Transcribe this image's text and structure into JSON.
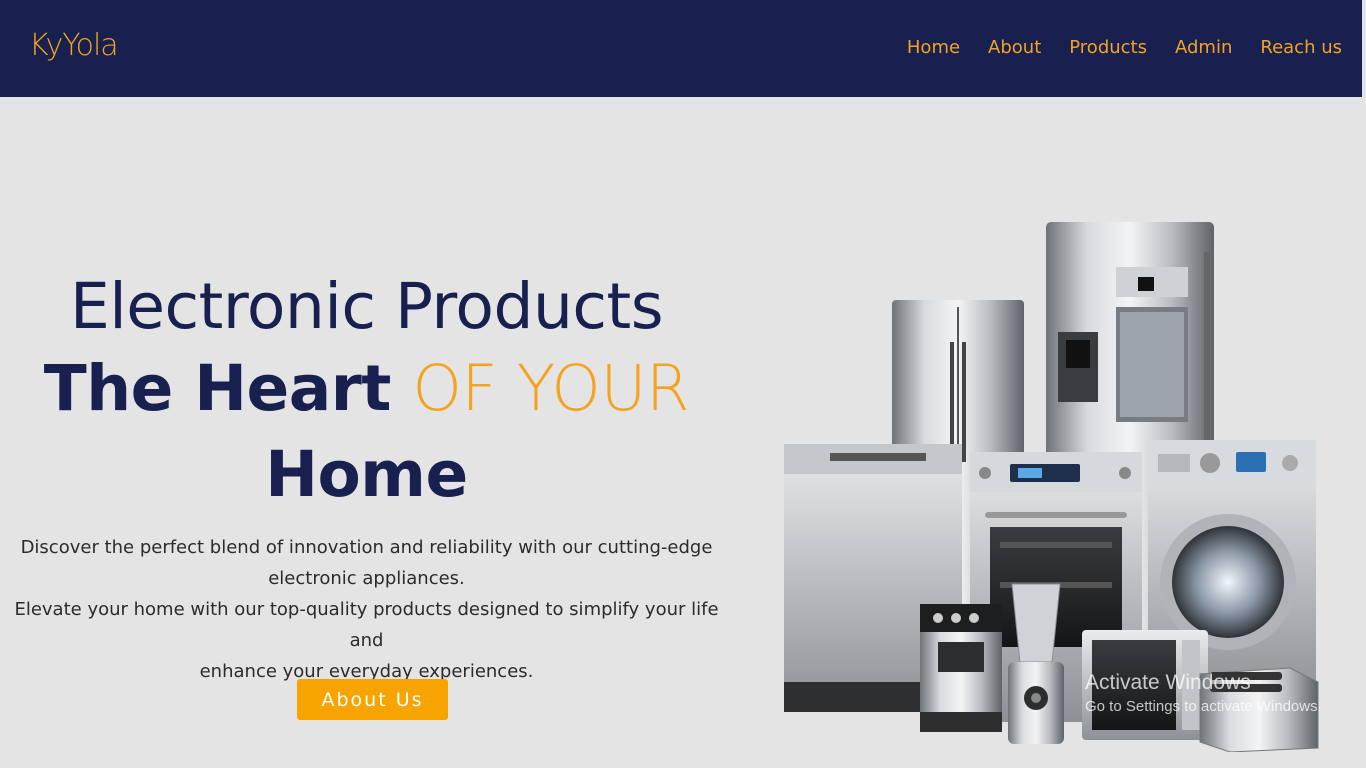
{
  "nav": {
    "logo": "KyYola",
    "links": [
      "Home",
      "About",
      "Products",
      "Admin",
      "Reach us"
    ]
  },
  "hero": {
    "title": "Electronic Products",
    "heading_bold": "The Heart",
    "heading_accent": "OF YOUR",
    "heading_end": "Home",
    "desc_line1": "Discover the perfect blend of innovation and reliability with our cutting-edge",
    "desc_line2": "electronic appliances.",
    "desc_line3": "Elevate your home with our top-quality products designed to simplify your life and",
    "desc_line4": "enhance your everyday experiences.",
    "button": "About Us"
  },
  "watermark": {
    "line1": "Activate Windows",
    "line2": "Go to Settings to activate Windows."
  },
  "colors": {
    "navy": "#17204f",
    "accent": "#f4a321",
    "background": "#e4e4e4"
  },
  "icons": [
    "refrigerator-icon",
    "dishwasher-icon",
    "oven-icon",
    "washing-machine-icon",
    "coffee-machine-icon",
    "blender-icon",
    "microwave-icon",
    "toaster-icon"
  ]
}
